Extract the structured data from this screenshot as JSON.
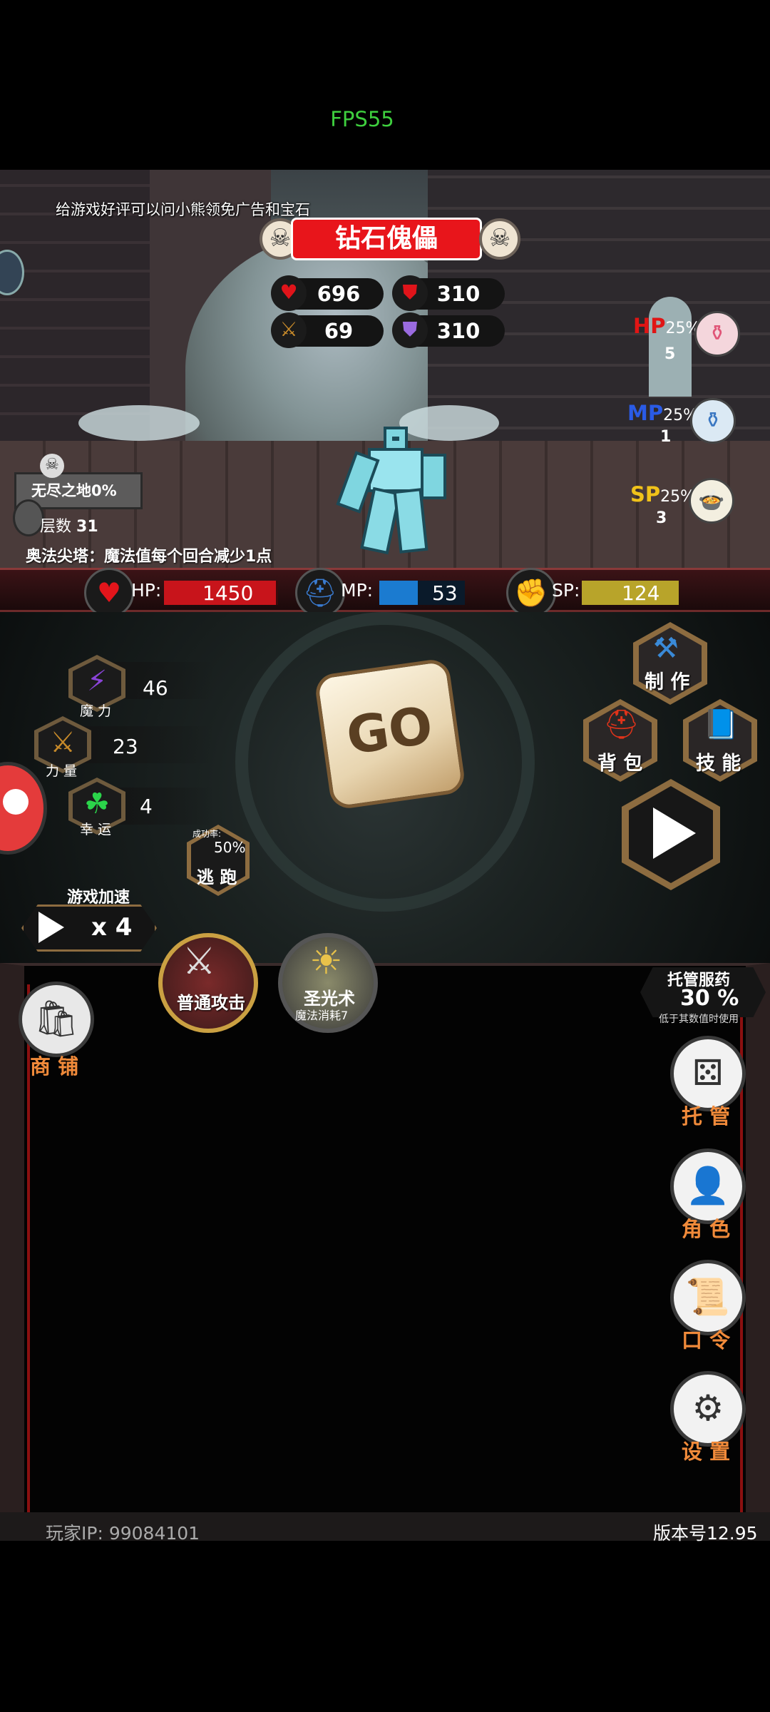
{
  "status": {
    "fps": "FPS55"
  },
  "notice": "给游戏好评可以问小熊领免广告和宝石",
  "boss": {
    "name": "钻石傀儡",
    "hp": "696",
    "defense": "310",
    "attack": "69",
    "magic_defense": "310"
  },
  "potions": [
    {
      "label": "HP",
      "percent": "25%",
      "count": "5",
      "color": "#e01515",
      "icon": "pink-potion-icon"
    },
    {
      "label": "MP",
      "percent": "25%",
      "count": "1",
      "color": "#2a5be6",
      "icon": "blue-potion-icon"
    },
    {
      "label": "SP",
      "percent": "25%",
      "count": "3",
      "color": "#f0c21a",
      "icon": "food-plate-icon"
    }
  ],
  "floor": {
    "zone": "无尽之地0%",
    "level_label": "层数",
    "level": "31",
    "tower_notice": "奥法尖塔：魔法值每个回合减少1点"
  },
  "player": {
    "hp_label": "HP:",
    "hp": "1450",
    "hp_fill": 0.98,
    "mp_label": "MP:",
    "mp": "53",
    "mp_fill": 0.45,
    "sp_label": "SP:",
    "sp": "124",
    "sp_fill": 1.0
  },
  "attributes": [
    {
      "label": "魔 力",
      "value": "46",
      "icon": "lightning-icon"
    },
    {
      "label": "力 量",
      "value": "23",
      "icon": "sword-icon"
    },
    {
      "label": "幸 运",
      "value": "4",
      "icon": "clover-icon"
    }
  ],
  "dice": {
    "label": "GO"
  },
  "flee": {
    "rate_label": "成功率:",
    "rate": "50%",
    "label": "逃 跑"
  },
  "menu": {
    "craft": "制 作",
    "bag": "背 包",
    "skills": "技 能"
  },
  "speed": {
    "title": "游戏加速",
    "value": "x 4"
  },
  "skills": {
    "normal_attack": "普通攻击",
    "holy_light": "圣光术",
    "holy_light_cost": "魔法消耗7"
  },
  "auto_potion": {
    "title": "托管服药",
    "value": "30 %",
    "subtitle": "低于其数值时使用"
  },
  "side_buttons": {
    "shop": "商 铺",
    "auto": "托 管",
    "character": "角 色",
    "code": "口 令",
    "settings": "设 置"
  },
  "footer": {
    "player_ip": "玩家IP:  99084101",
    "version": "版本号12.95"
  }
}
